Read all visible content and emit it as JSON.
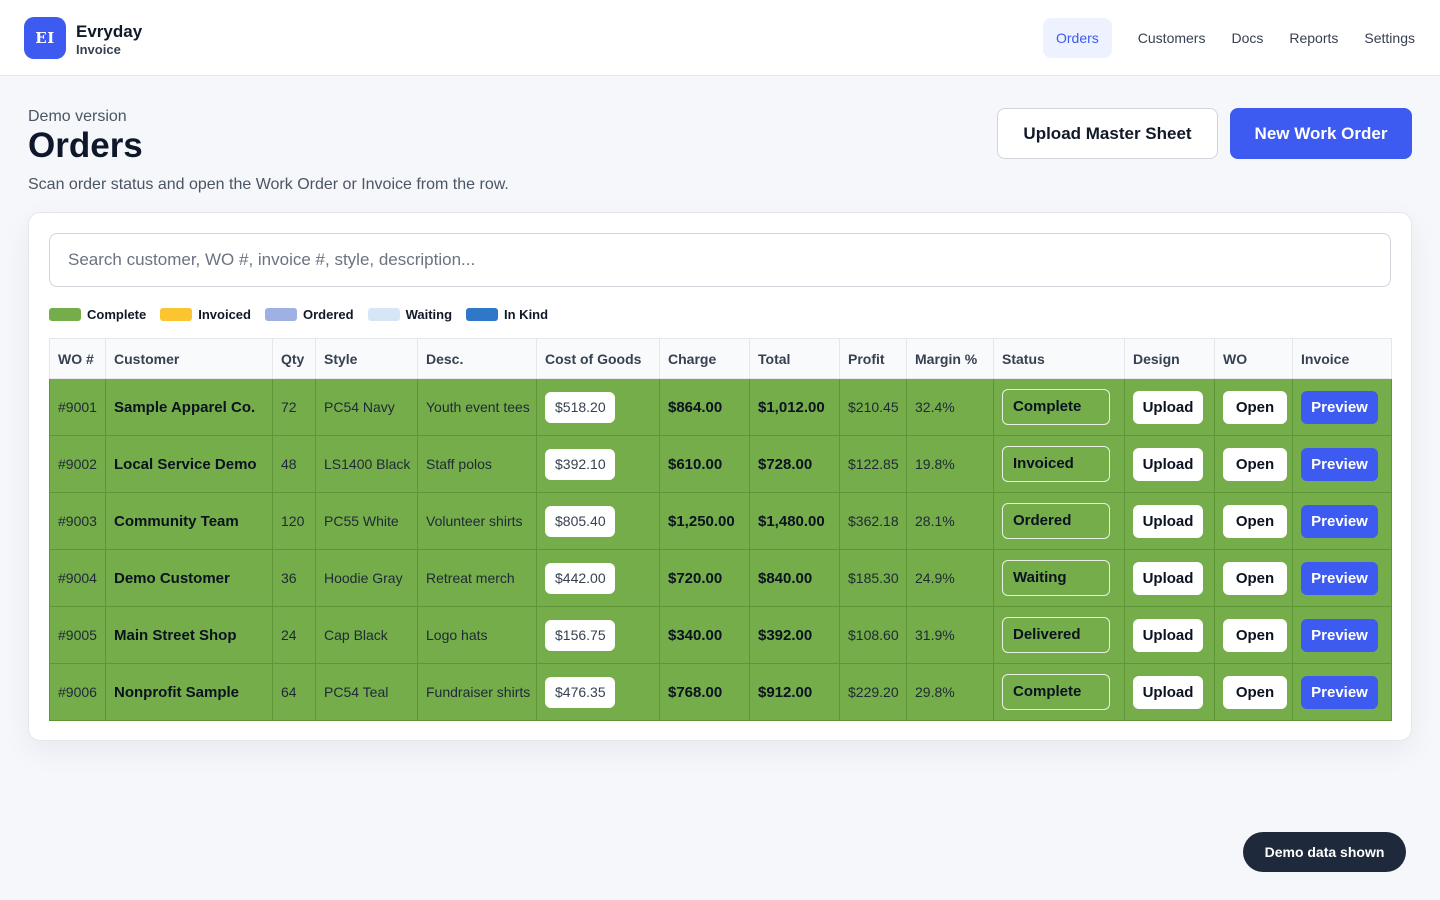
{
  "brand": {
    "logo_text": "EI",
    "name": "Evryday",
    "sub": "Invoice"
  },
  "nav": [
    {
      "label": "Orders",
      "active": true
    },
    {
      "label": "Customers"
    },
    {
      "label": "Docs"
    },
    {
      "label": "Reports"
    },
    {
      "label": "Settings"
    }
  ],
  "page": {
    "eyebrow": "Demo version",
    "title": "Orders",
    "description": "Scan order status and open the Work Order or Invoice from the row.",
    "upload_master_label": "Upload Master Sheet",
    "new_work_order_label": "New Work Order"
  },
  "search": {
    "placeholder": "Search customer, WO #, invoice #, style, description..."
  },
  "legend": [
    {
      "label": "Complete",
      "color": "#74ad4a"
    },
    {
      "label": "Invoiced",
      "color": "#fbc531"
    },
    {
      "label": "Ordered",
      "color": "#9fb1e3"
    },
    {
      "label": "Waiting",
      "color": "#d6e6f7"
    },
    {
      "label": "In Kind",
      "color": "#2f78c8"
    }
  ],
  "table": {
    "columns": [
      "WO #",
      "Customer",
      "Qty",
      "Style",
      "Desc.",
      "Cost of Goods",
      "Charge",
      "Total",
      "Profit",
      "Margin %",
      "Status",
      "Design",
      "WO",
      "Invoice"
    ],
    "row_color": "#74ad4a",
    "design_button": "Upload",
    "wo_button": "Open",
    "invoice_button": "Preview",
    "rows": [
      {
        "wo": "#9001",
        "customer": "Sample Apparel Co.",
        "qty": "72",
        "style": "PC54 Navy",
        "desc": "Youth event tees",
        "cost": "$518.20",
        "charge": "$864.00",
        "total": "$1,012.00",
        "profit": "$210.45",
        "margin": "32.4%",
        "status": "Complete"
      },
      {
        "wo": "#9002",
        "customer": "Local Service Demo",
        "qty": "48",
        "style": "LS1400 Black",
        "desc": "Staff polos",
        "cost": "$392.10",
        "charge": "$610.00",
        "total": "$728.00",
        "profit": "$122.85",
        "margin": "19.8%",
        "status": "Invoiced"
      },
      {
        "wo": "#9003",
        "customer": "Community Team",
        "qty": "120",
        "style": "PC55 White",
        "desc": "Volunteer shirts",
        "cost": "$805.40",
        "charge": "$1,250.00",
        "total": "$1,480.00",
        "profit": "$362.18",
        "margin": "28.1%",
        "status": "Ordered"
      },
      {
        "wo": "#9004",
        "customer": "Demo Customer",
        "qty": "36",
        "style": "Hoodie Gray",
        "desc": "Retreat merch",
        "cost": "$442.00",
        "charge": "$720.00",
        "total": "$840.00",
        "profit": "$185.30",
        "margin": "24.9%",
        "status": "Waiting"
      },
      {
        "wo": "#9005",
        "customer": "Main Street Shop",
        "qty": "24",
        "style": "Cap Black",
        "desc": "Logo hats",
        "cost": "$156.75",
        "charge": "$340.00",
        "total": "$392.00",
        "profit": "$108.60",
        "margin": "31.9%",
        "status": "Delivered"
      },
      {
        "wo": "#9006",
        "customer": "Nonprofit Sample",
        "qty": "64",
        "style": "PC54 Teal",
        "desc": "Fundraiser shirts",
        "cost": "$476.35",
        "charge": "$768.00",
        "total": "$912.00",
        "profit": "$229.20",
        "margin": "29.8%",
        "status": "Complete"
      }
    ]
  },
  "toast": {
    "label": "Demo data shown"
  }
}
